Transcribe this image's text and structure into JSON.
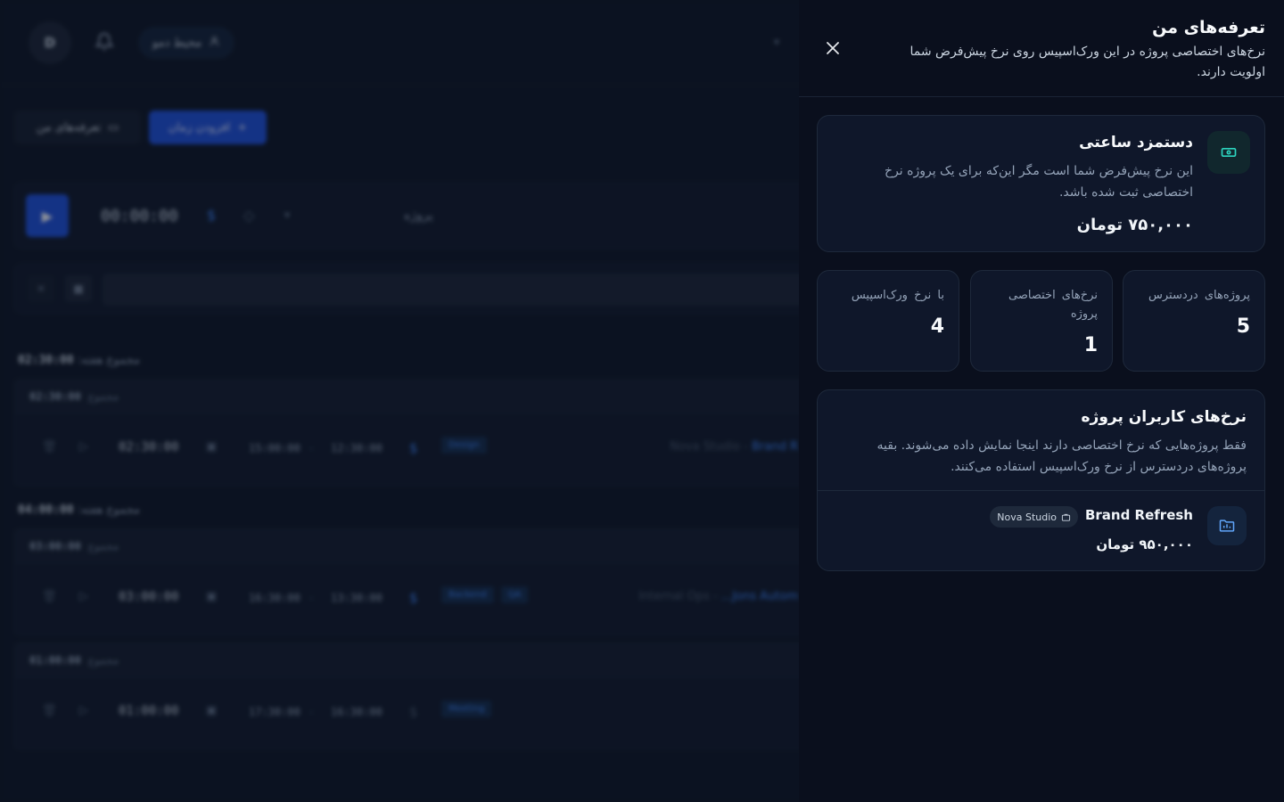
{
  "background": {
    "avatar_initial": "D",
    "workspace_badge": "محیط دمو",
    "rates_button": "تعرفه‌های من",
    "add_time_button": "افزودن زمان",
    "timer": {
      "time": "00:00:00",
      "project_placeholder": "پروژه"
    },
    "weeks": [
      {
        "label": "مجموع هفته:",
        "total": "02:30:00",
        "groups": [
          {
            "label": "مجموع",
            "total": "02:30:00",
            "entry": {
              "duration": "02:30:00",
              "end": "15:00:00",
              "start": "12:30:00",
              "tags": [
                "Design"
              ],
              "client": "Nova Studio",
              "project": "Brand R"
            }
          }
        ]
      },
      {
        "label": "مجموع هفته:",
        "total": "04:00:00",
        "groups": [
          {
            "label": "مجموع",
            "total": "03:00:00",
            "entry": {
              "duration": "03:00:00",
              "end": "16:30:00",
              "start": "13:30:00",
              "tags": [
                "Backend",
                "QA"
              ],
              "client": "Internal Ops",
              "project": "...Jons Autom"
            }
          },
          {
            "label": "مجموع",
            "total": "01:00:00",
            "entry": {
              "duration": "01:00:00",
              "end": "17:30:00",
              "start": "16:30:00",
              "tags": [
                "Meeting"
              ],
              "client": "",
              "project": ""
            }
          }
        ]
      }
    ]
  },
  "drawer": {
    "title": "تعرفه‌های من",
    "subtitle": "نرخ‌های اختصاصی پروژه در این ورک‌اسپیس روی نرخ پیش‌فرض شما اولویت دارند.",
    "hourly": {
      "title": "دستمزد ساعتی",
      "description": "این نرخ پیش‌فرض شما است مگر این‌که برای یک پروژه نرخ اختصاصی ثبت شده باشد.",
      "value": "۷۵۰,۰۰۰ تومان",
      "icon": "cash-icon"
    },
    "stats": [
      {
        "label": "پروژه‌های دردسترس",
        "value": "5"
      },
      {
        "label": "نرخ‌های اختصاصی پروژه",
        "value": "1"
      },
      {
        "label": "با نرخ ورک‌اسپیس",
        "value": "4"
      }
    ],
    "project_rates": {
      "title": "نرخ‌های کاربران پروژه",
      "description": "فقط پروژه‌هایی که نرخ اختصاصی دارند اینجا نمایش داده می‌شوند. بقیه پروژه‌های دردسترس از نرخ ورک‌اسپیس استفاده می‌کنند.",
      "items": [
        {
          "name": "Brand Refresh",
          "client": "Nova Studio",
          "rate": "۹۵۰,۰۰۰ تومان",
          "icon": "folder-chart-icon"
        }
      ]
    },
    "colors": {
      "accent_teal": "#2dd4bf",
      "accent_blue": "#60a5fa",
      "drawer_bg": "#0a0f1d"
    }
  }
}
